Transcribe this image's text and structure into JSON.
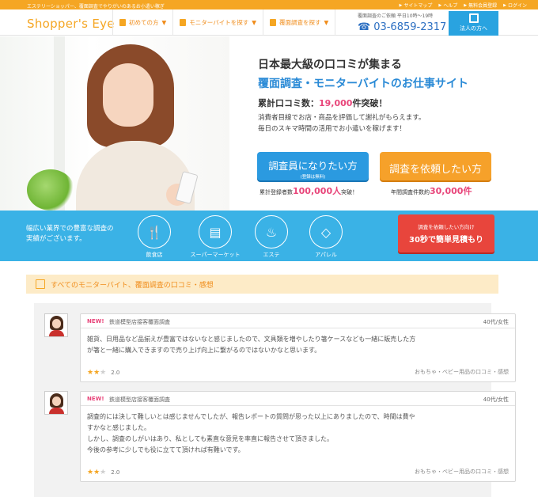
{
  "topbar": {
    "tagline": "エステリーショッパー、覆面調査でやりがいのあるお小遣い稼ぎ",
    "links": [
      {
        "label": "サイトマップ",
        "icon": "arrow-icon"
      },
      {
        "label": "ヘルプ",
        "icon": "arrow-icon"
      },
      {
        "label": "無料会員登録",
        "icon": "arrow-icon"
      },
      {
        "label": "ログイン",
        "icon": "arrow-icon"
      }
    ]
  },
  "header": {
    "logo": "Shopper's Eye",
    "nav": [
      {
        "label": "初めての方",
        "icon": "leaf-icon"
      },
      {
        "label": "モニターバイトを探す",
        "icon": "document-icon"
      },
      {
        "label": "覆面調査を探す",
        "icon": "clipboard-icon"
      }
    ],
    "nav_arrow": "▼",
    "phone_caption": "覆面調査のご依頼 平日10時〜19時",
    "phone_number": "03-6859-2317",
    "corp_label": "法人の方へ"
  },
  "hero": {
    "headline1": "日本最大級の口コミが集まる",
    "headline2": "覆面調査・モニターバイトのお仕事サイト",
    "count_label": "累計口コミ数：",
    "count_value": "19,000",
    "count_suffix": "件突破！",
    "desc1": "消費者目線でお店・商品を評価して謝礼がもらえます。",
    "desc2": "毎日のスキマ時間の活用でお小遣いを稼げます！",
    "cta_researcher": "調査員になりたい方",
    "cta_researcher_sub": "(登録は無料)",
    "cta_request": "調査を依頼したい方",
    "stat_left_label": "累計登録者数",
    "stat_left_value": "100,000人",
    "stat_left_suffix": "突破！",
    "stat_right_label": "年間調査件数約",
    "stat_right_value": "30,000件"
  },
  "band": {
    "text1": "幅広い業界での豊富な調査の",
    "text2": "実績がございます。",
    "categories": [
      {
        "label": "飲食店",
        "icon": "utensils-icon"
      },
      {
        "label": "スーパーマーケット",
        "icon": "store-icon"
      },
      {
        "label": "エステ",
        "icon": "bathtub-icon"
      },
      {
        "label": "アパレル",
        "icon": "diamond-icon"
      }
    ],
    "quote_line1": "調査を依頼したい方向け",
    "quote_line2": "30秒で簡単見積もり"
  },
  "section": {
    "title": "すべてのモニターバイト、覆面調査の口コミ・感想"
  },
  "reviews": [
    {
      "badge": "NEW!",
      "shop": "鉄道模型店接客覆面調査",
      "who": "40代/女性",
      "lines": [
        "雑貨、日用品など品揃えが豊富ではないなと感じましたので、文具類を増やしたり箸ケースなども一緒に販売した方",
        "が箸と一緒に購入できますので売り上げ向上に繋がるのではないかなと思います。"
      ],
      "rating": "2.0",
      "category": "おもちゃ・ベビー用品の口コミ・感想"
    },
    {
      "badge": "NEW!",
      "shop": "鉄道模型店接客覆面調査",
      "who": "40代/女性",
      "lines": [
        "調査的には決して難しいとは感じませんでしたが、報告レポートの質問が思った以上にありましたので、時間は費や",
        "すかなと感じました。",
        "しかし、調査のしがいはあり、私としても素直な意見を率直に報告させて頂きました。",
        "今後の参考に少しでも役に立てて頂ければ有難いです。"
      ],
      "rating": "2.0",
      "category": "おもちゃ・ベビー用品の口コミ・感想"
    }
  ],
  "colors": {
    "accent": "#f5a623",
    "blue": "#2b9ae0",
    "band": "#3ab2e6",
    "red": "#e8453c",
    "pink": "#e8457a"
  }
}
